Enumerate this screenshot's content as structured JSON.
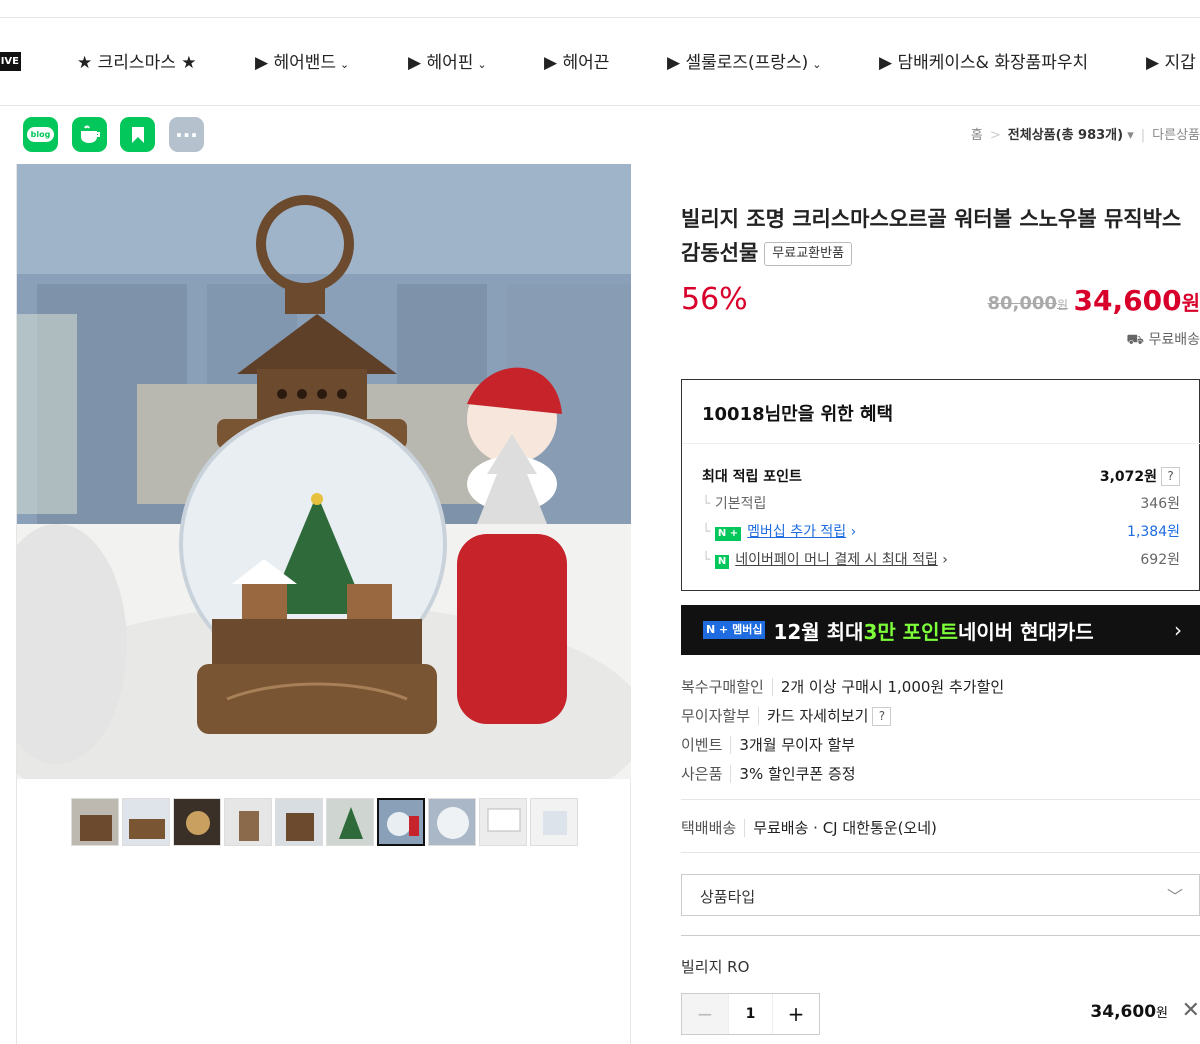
{
  "nav": {
    "live_badge": "IVE",
    "items": [
      {
        "label": "★ 크리스마스 ★"
      },
      {
        "label": "▶ 헤어밴드"
      },
      {
        "label": "▶ 헤어핀"
      },
      {
        "label": "▶ 헤어끈"
      },
      {
        "label": "▶ 셀룰로즈(프랑스)"
      },
      {
        "label": "▶ 담배케이스& 화장품파우치"
      },
      {
        "label": "▶ 지갑"
      }
    ]
  },
  "share": {
    "blog": "blog",
    "more": "···"
  },
  "breadcrumb": {
    "home": "홈",
    "category": "전체상품(총 983개)",
    "other": "다른상품"
  },
  "product": {
    "title": "빌리지 조명 크리스마스오르골 워터볼 스노우볼 뮤직박스 감동선물",
    "tag": "무료교환반품",
    "discount": "56%",
    "original_price": "80,000",
    "original_unit": "원",
    "price": "34,600",
    "price_unit": "원",
    "shipping": "무료배송"
  },
  "benefit": {
    "title": "10018님만을 위한 혜택",
    "max_label": "최대 적립 포인트",
    "max_value": "3,072원",
    "basic_label": "기본적립",
    "basic_value": "346원",
    "membership_badge": "N +",
    "membership_label": "멤버십 추가 적립",
    "membership_value": "1,384원",
    "pay_badge": "N",
    "pay_label": "네이버페이 머니 결제 시 최대 적립",
    "pay_value": "692원"
  },
  "banner": {
    "badge": "N + 멤버십",
    "text_a": "12월 최대 ",
    "text_b": "3만 포인트",
    "text_c": " 네이버 현대카드",
    "arrow": "›"
  },
  "options": [
    {
      "key": "복수구매할인",
      "value": "2개 이상 구매시 1,000원 추가할인"
    },
    {
      "key": "무이자할부",
      "value": "카드 자세히보기"
    },
    {
      "key": "이벤트",
      "value": "3개월 무이자 할부"
    },
    {
      "key": "사은품",
      "value": "3% 할인쿠폰 증정"
    }
  ],
  "delivery": {
    "key": "택배배송",
    "value": "무료배송 · CJ 대한통운(오네)"
  },
  "select": {
    "placeholder": "상품타입"
  },
  "selected": {
    "name": "빌리지 RO",
    "qty": "1",
    "minus": "−",
    "plus": "+",
    "price": "34,600",
    "unit": "원",
    "remove": "✕"
  },
  "colors": {
    "accent_red": "#d8002a",
    "naver_green": "#03c75a",
    "link_blue": "#1e6ce0"
  }
}
